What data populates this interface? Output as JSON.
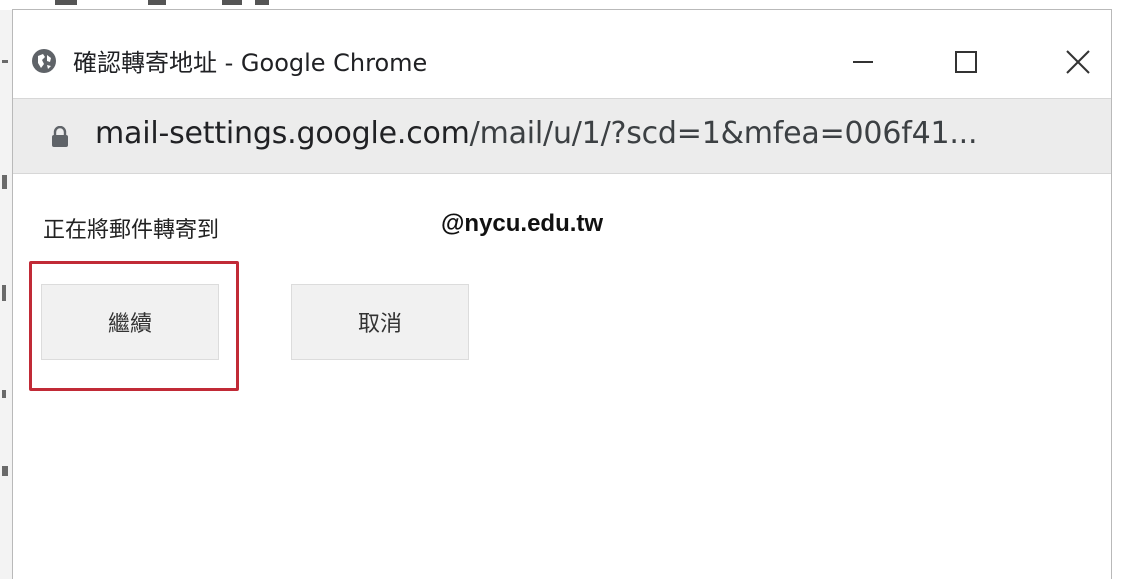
{
  "window": {
    "title": "確認轉寄地址 - Google Chrome",
    "icon": "globe-icon",
    "controls": {
      "minimize_icon": "minimize-icon",
      "maximize_icon": "maximize-icon",
      "close_icon": "close-icon"
    }
  },
  "address_bar": {
    "icon": "lock-icon",
    "host": "mail-settings.google.com",
    "path": "/mail/u/1/?scd=1&mfea=006f41..."
  },
  "dialog": {
    "message_label": "正在將郵件轉寄到",
    "email": "@nycu.edu.tw",
    "continue_label": "繼續",
    "cancel_label": "取消"
  },
  "colors": {
    "highlight": "#c12a36",
    "button_bg": "#f1f1f1",
    "urlbar_bg": "#ececec"
  }
}
